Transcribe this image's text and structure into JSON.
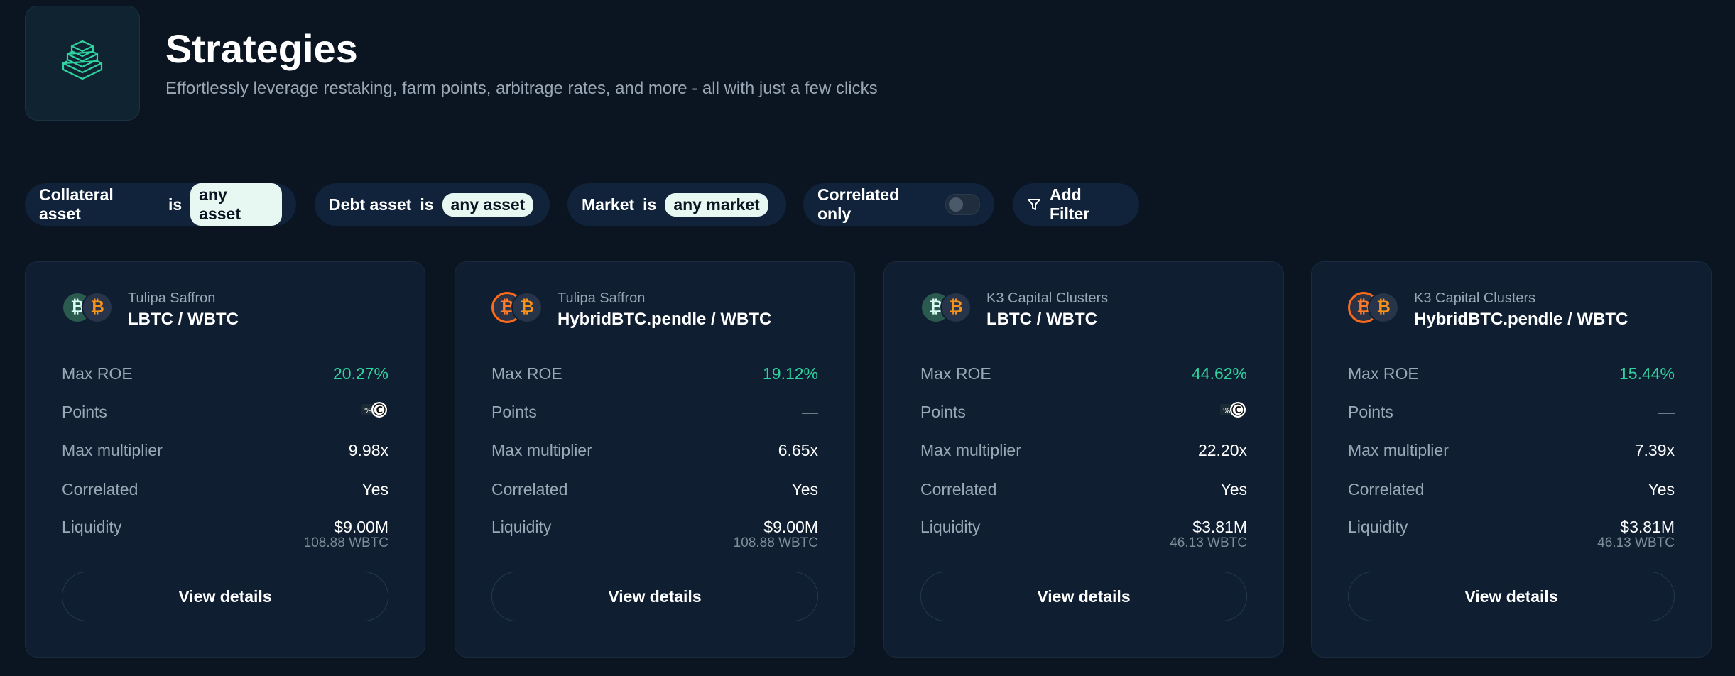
{
  "header": {
    "title": "Strategies",
    "subtitle": "Effortlessly leverage restaking, farm points, arbitrage rates, and more - all with just a few clicks",
    "logo_icon": "stacked-layers-icon"
  },
  "filters": {
    "collateral": {
      "label": "Collateral asset",
      "op": "is",
      "value": "any asset"
    },
    "debt": {
      "label": "Debt asset",
      "op": "is",
      "value": "any asset"
    },
    "market": {
      "label": "Market",
      "op": "is",
      "value": "any market"
    },
    "correlated": {
      "label": "Correlated only",
      "enabled": false
    },
    "add_filter": {
      "label": "Add Filter",
      "icon": "funnel-icon"
    }
  },
  "labels": {
    "max_roe": "Max ROE",
    "points": "Points",
    "max_multiplier": "Max multiplier",
    "correlated": "Correlated",
    "liquidity": "Liquidity",
    "view_details": "View details"
  },
  "colors": {
    "accent_green": "#2fd3a0",
    "background": "#0a1521",
    "card": "#0f1f31",
    "pill": "#e7f7f2"
  },
  "cards": [
    {
      "curator": "Tulipa Saffron",
      "pair": "LBTC / WBTC",
      "collateral_icon": "lbtc-icon",
      "debt_icon": "wbtc-icon",
      "max_roe": "20.27%",
      "points": "points-badge-icon",
      "max_multiplier": "9.98x",
      "correlated": "Yes",
      "liquidity": "$9.00M",
      "liquidity_sub": "108.88 WBTC"
    },
    {
      "curator": "Tulipa Saffron",
      "pair": "HybridBTC.pendle / WBTC",
      "collateral_icon": "hybridbtc-icon",
      "debt_icon": "wbtc-icon",
      "max_roe": "19.12%",
      "points": "—",
      "max_multiplier": "6.65x",
      "correlated": "Yes",
      "liquidity": "$9.00M",
      "liquidity_sub": "108.88 WBTC"
    },
    {
      "curator": "K3 Capital Clusters",
      "pair": "LBTC / WBTC",
      "collateral_icon": "lbtc-icon",
      "debt_icon": "wbtc-icon",
      "max_roe": "44.62%",
      "points": "points-badge-icon",
      "max_multiplier": "22.20x",
      "correlated": "Yes",
      "liquidity": "$3.81M",
      "liquidity_sub": "46.13 WBTC"
    },
    {
      "curator": "K3 Capital Clusters",
      "pair": "HybridBTC.pendle / WBTC",
      "collateral_icon": "hybridbtc-icon",
      "debt_icon": "wbtc-icon",
      "max_roe": "15.44%",
      "points": "—",
      "max_multiplier": "7.39x",
      "correlated": "Yes",
      "liquidity": "$3.81M",
      "liquidity_sub": "46.13 WBTC"
    }
  ]
}
